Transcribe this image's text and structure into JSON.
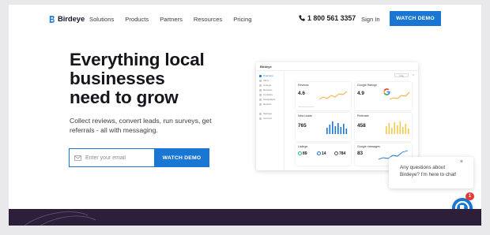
{
  "header": {
    "brand": "Birdeye",
    "nav": [
      "Solutions",
      "Products",
      "Partners",
      "Resources",
      "Pricing"
    ],
    "phone": "1 800 561 3357",
    "signin": "Sign In",
    "cta": "WATCH DEMO"
  },
  "hero": {
    "title_lines": [
      "Everything local",
      "businesses",
      "need to grow"
    ],
    "subtitle": "Collect reviews, convert leads, run surveys, get referrals - all with messaging.",
    "email_placeholder": "Enter your email",
    "cta": "WATCH DEMO"
  },
  "dashboard": {
    "logo": "Birdeye",
    "sidebar": [
      "Overview",
      "Inbox",
      "Listings",
      "Reviews",
      "Contacts",
      "Campaigns",
      "Reports",
      "Settings",
      "Account"
    ],
    "control": "Live",
    "cards": {
      "reviews": {
        "title": "Reviews",
        "value": "4.6"
      },
      "google_ratings": {
        "title": "Google Ratings",
        "value": "4.9"
      },
      "new_leads": {
        "title": "New Leads",
        "value": "765"
      },
      "referrals": {
        "title": "Referrals",
        "value": "458"
      },
      "listings": {
        "title": "Listings",
        "a": "89",
        "b": "14",
        "c": "784"
      },
      "google_messages": {
        "title": "Google messages",
        "value": "83"
      }
    },
    "colors": {
      "accent": "#1976d2",
      "chart_orange": "#f5a623",
      "chart_blue": "#1976d2",
      "chart_yellow": "#f2c94c"
    }
  },
  "chat": {
    "message": "Any questions about Birdeye? I'm here to chat!",
    "badge": "1",
    "close": "×"
  }
}
